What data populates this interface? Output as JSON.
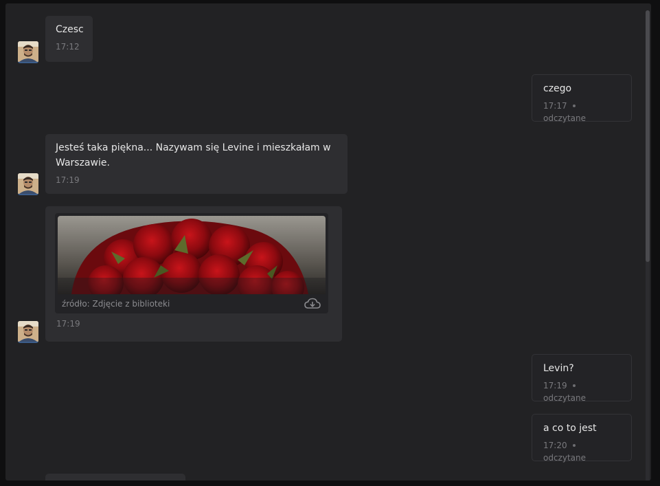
{
  "messages": [
    {
      "direction": "in",
      "text": "Czesc",
      "time": "17:12"
    },
    {
      "direction": "out",
      "text": "czego",
      "time": "17:17",
      "status": "odczytane"
    },
    {
      "direction": "in",
      "text": "Jesteś taka piękna... Nazywam się Levine i mieszkałam w Warszawie.",
      "time": "17:19"
    },
    {
      "direction": "in",
      "type": "image",
      "caption": "źródło: Zdjęcie z biblioteki",
      "time": "17:19"
    },
    {
      "direction": "out",
      "text": "Levin?",
      "time": "17:19",
      "status": "odczytane"
    },
    {
      "direction": "out",
      "text": "a co to jest",
      "time": "17:20",
      "status": "odczytane"
    }
  ],
  "icons": {
    "avatar": "avatar-photo",
    "download": "cloud-download-icon"
  },
  "colors": {
    "window_bg": "#222224",
    "incoming_bubble": "#2e2e31",
    "outgoing_bubble": "#232326",
    "text": "#e7e7e7",
    "meta_text": "#7a7a7e",
    "avatar_accent": "#3c5d8a"
  }
}
